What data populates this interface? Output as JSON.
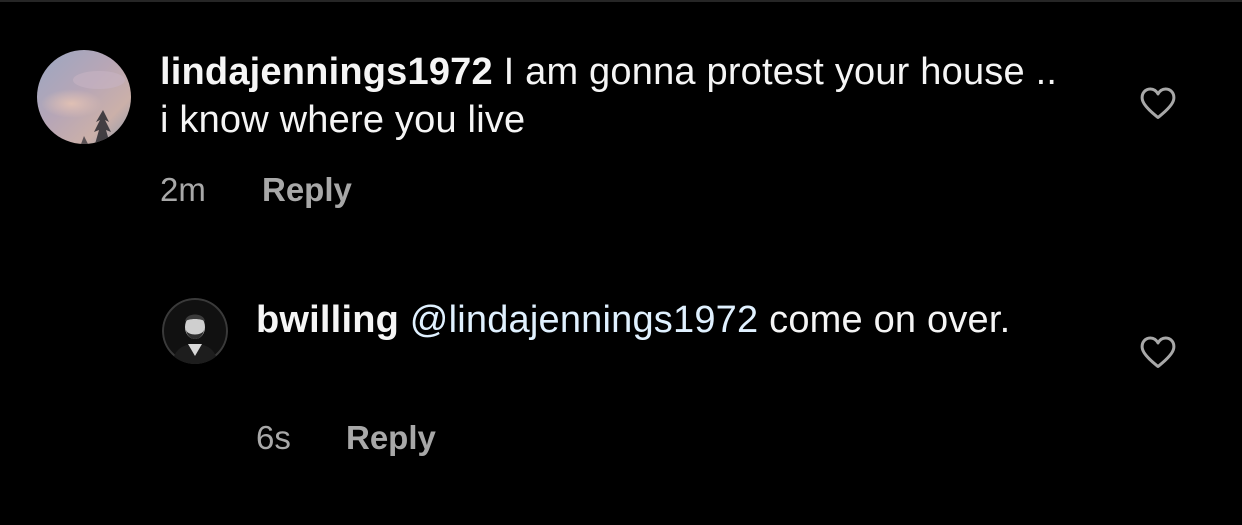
{
  "comments": [
    {
      "username": "lindajennings1972",
      "text": " I am gonna protest your house .. i know where you live",
      "time": "2m",
      "reply_label": "Reply",
      "avatar_icon": "sky-sunset-avatar-icon",
      "like_icon": "heart-outline-icon"
    },
    {
      "username": "bwilling",
      "mention": "@lindajennings1972",
      "text": " come on over.",
      "time": "6s",
      "reply_label": "Reply",
      "avatar_icon": "person-portrait-avatar-icon",
      "like_icon": "heart-outline-icon"
    }
  ],
  "colors": {
    "background": "#000000",
    "primary_text": "#f5f5f5",
    "secondary_text": "#a8a8a8",
    "mention": "#e0f1ff"
  }
}
